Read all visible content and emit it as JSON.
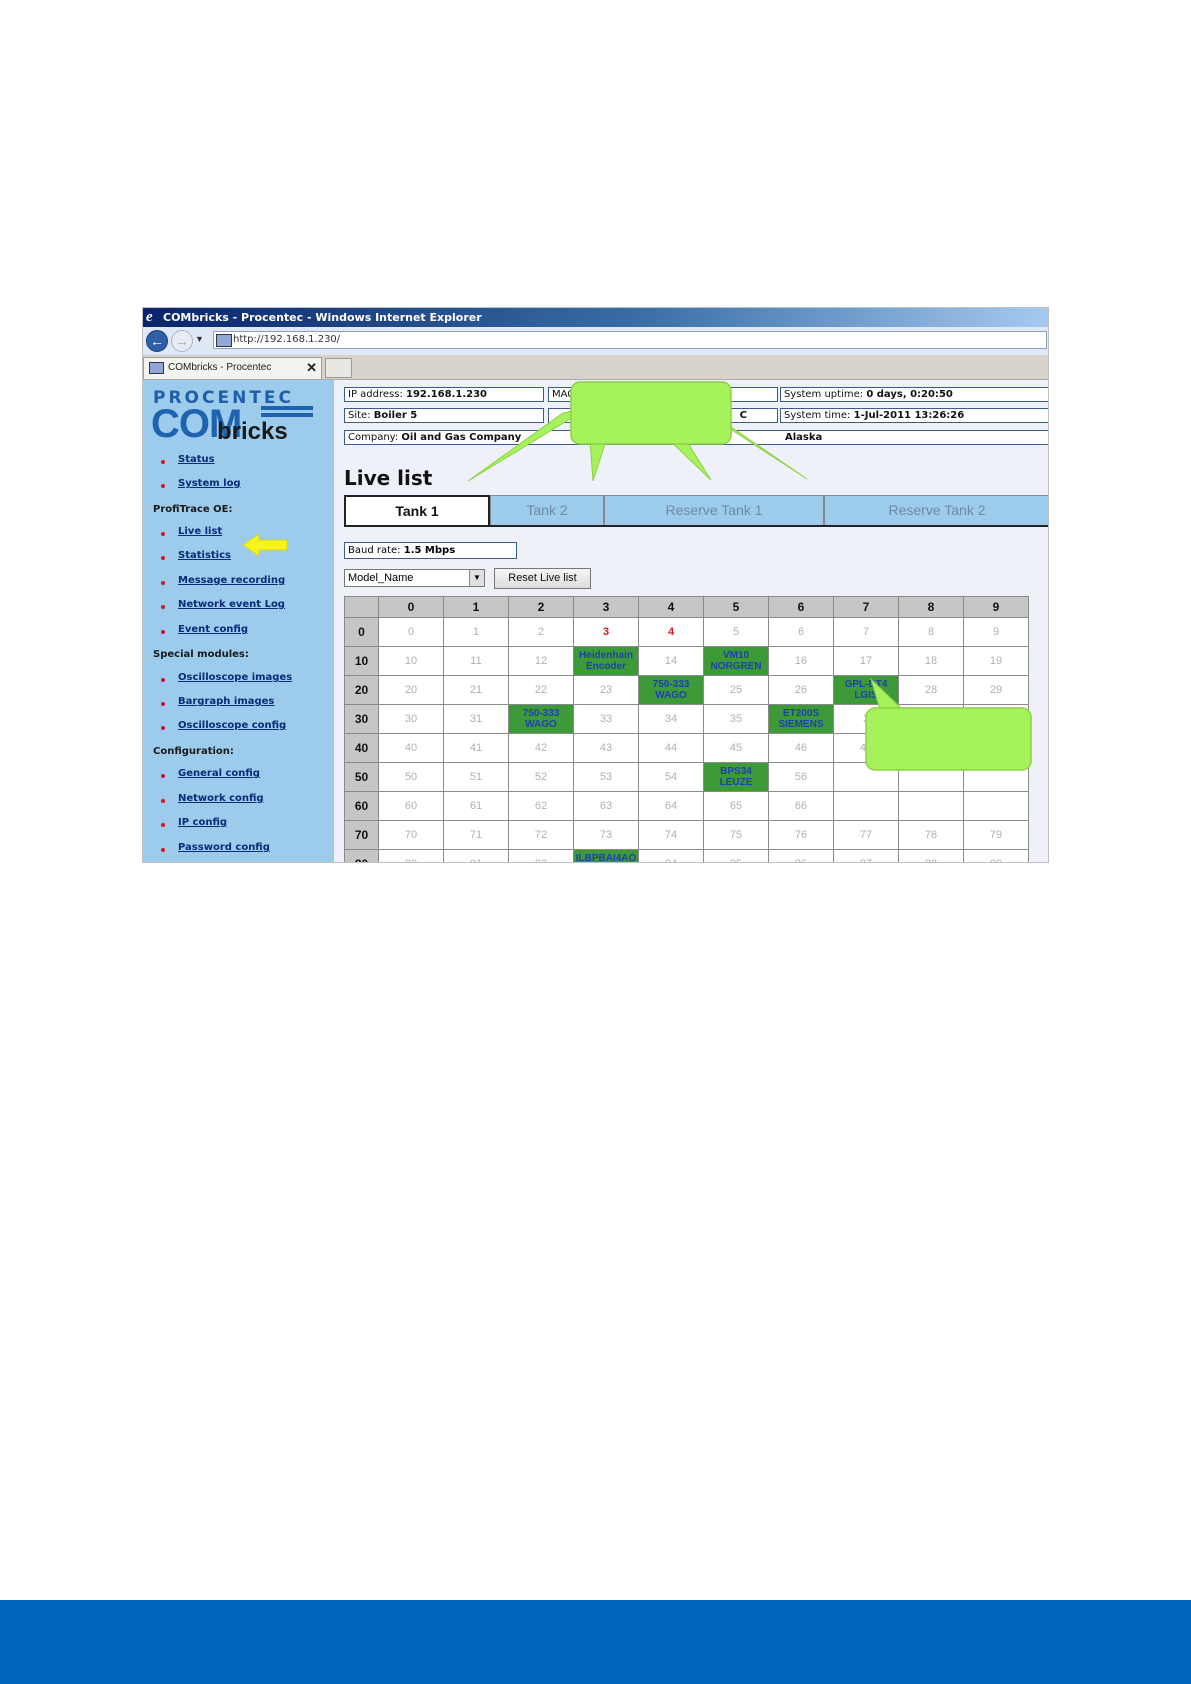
{
  "window": {
    "title": "COMbricks - Procentec - Windows Internet Explorer",
    "url": "http://192.168.1.230/",
    "tab_title": "COMbricks - Procentec"
  },
  "logo": {
    "top": "PROCENTEC",
    "big": "COM",
    "sub": "bricks"
  },
  "sidebar": {
    "links_top": [
      "Status",
      "System log"
    ],
    "section_profitrace": "ProfiTrace OE:",
    "links_profitrace": [
      "Live list",
      "Statistics",
      "Message recording",
      "Network event Log",
      "Event config"
    ],
    "section_special": "Special modules:",
    "links_special": [
      "Oscilloscope images",
      "Bargraph images",
      "Oscilloscope config"
    ],
    "section_config": "Configuration:",
    "links_config": [
      "General config",
      "Network config",
      "IP config",
      "Password config"
    ]
  },
  "info": {
    "ip_label": "IP address:",
    "ip_value": "192.168.1.230",
    "mac_label": "MAC",
    "site_label": "Site:",
    "site_value": "Boiler 5",
    "mid_value": "C",
    "company_label": "Company:",
    "company_value": "Oil and Gas Company",
    "loc_value": "Alaska",
    "uptime_label": "System uptime:",
    "uptime_value": "0 days, 0:20:50",
    "time_label": "System time:",
    "time_value": "1-Jul-2011 13:26:26"
  },
  "page": {
    "title": "Live list",
    "tabs": [
      "Tank 1",
      "Tank 2",
      "Reserve Tank 1",
      "Reserve Tank 2"
    ],
    "baud_label": "Baud rate:",
    "baud_value": "1.5 Mbps",
    "select_value": "Model_Name",
    "reset_button": "Reset Live list"
  },
  "grid": {
    "columns": [
      "0",
      "1",
      "2",
      "3",
      "4",
      "5",
      "6",
      "7",
      "8",
      "9"
    ],
    "rows": [
      {
        "label": "0",
        "cells": [
          "0",
          "1",
          "2",
          "3",
          "4",
          "5",
          "6",
          "7",
          "8",
          "9"
        ]
      },
      {
        "label": "10",
        "cells": [
          "10",
          "11",
          "12",
          "Heidenhain\nEncoder",
          "14",
          "VM10\nNORGREN",
          "16",
          "17",
          "18",
          "19"
        ]
      },
      {
        "label": "20",
        "cells": [
          "20",
          "21",
          "22",
          "23",
          "750-333\nWAGO",
          "25",
          "26",
          "GPL-DT4\nLGIS",
          "28",
          "29"
        ]
      },
      {
        "label": "30",
        "cells": [
          "30",
          "31",
          "750-333\nWAGO",
          "33",
          "34",
          "35",
          "ET200S\nSIEMENS",
          "3",
          "38",
          "39"
        ]
      },
      {
        "label": "40",
        "cells": [
          "40",
          "41",
          "42",
          "43",
          "44",
          "45",
          "46",
          "47",
          "48",
          "49"
        ]
      },
      {
        "label": "50",
        "cells": [
          "50",
          "51",
          "52",
          "53",
          "54",
          "BPS34\nLEUZE",
          "56",
          "",
          "",
          ""
        ]
      },
      {
        "label": "60",
        "cells": [
          "60",
          "61",
          "62",
          "63",
          "64",
          "65",
          "66",
          "",
          "",
          ""
        ]
      },
      {
        "label": "70",
        "cells": [
          "70",
          "71",
          "72",
          "73",
          "74",
          "75",
          "76",
          "77",
          "78",
          "79"
        ]
      },
      {
        "label": "80",
        "cells": [
          "80",
          "81",
          "82",
          "ILBPBAI4AO\nPHOENIX",
          "84",
          "85",
          "86",
          "87",
          "88",
          "89"
        ]
      }
    ],
    "red_cells": [
      "0-3",
      "0-4"
    ],
    "device_cells": [
      "1-3",
      "1-5",
      "2-4",
      "2-7",
      "3-2",
      "3-6",
      "5-5",
      "8-3"
    ]
  },
  "colors": {
    "callout": "#a6f25a",
    "device": "#3d9a38",
    "footer": "#0067bd"
  }
}
